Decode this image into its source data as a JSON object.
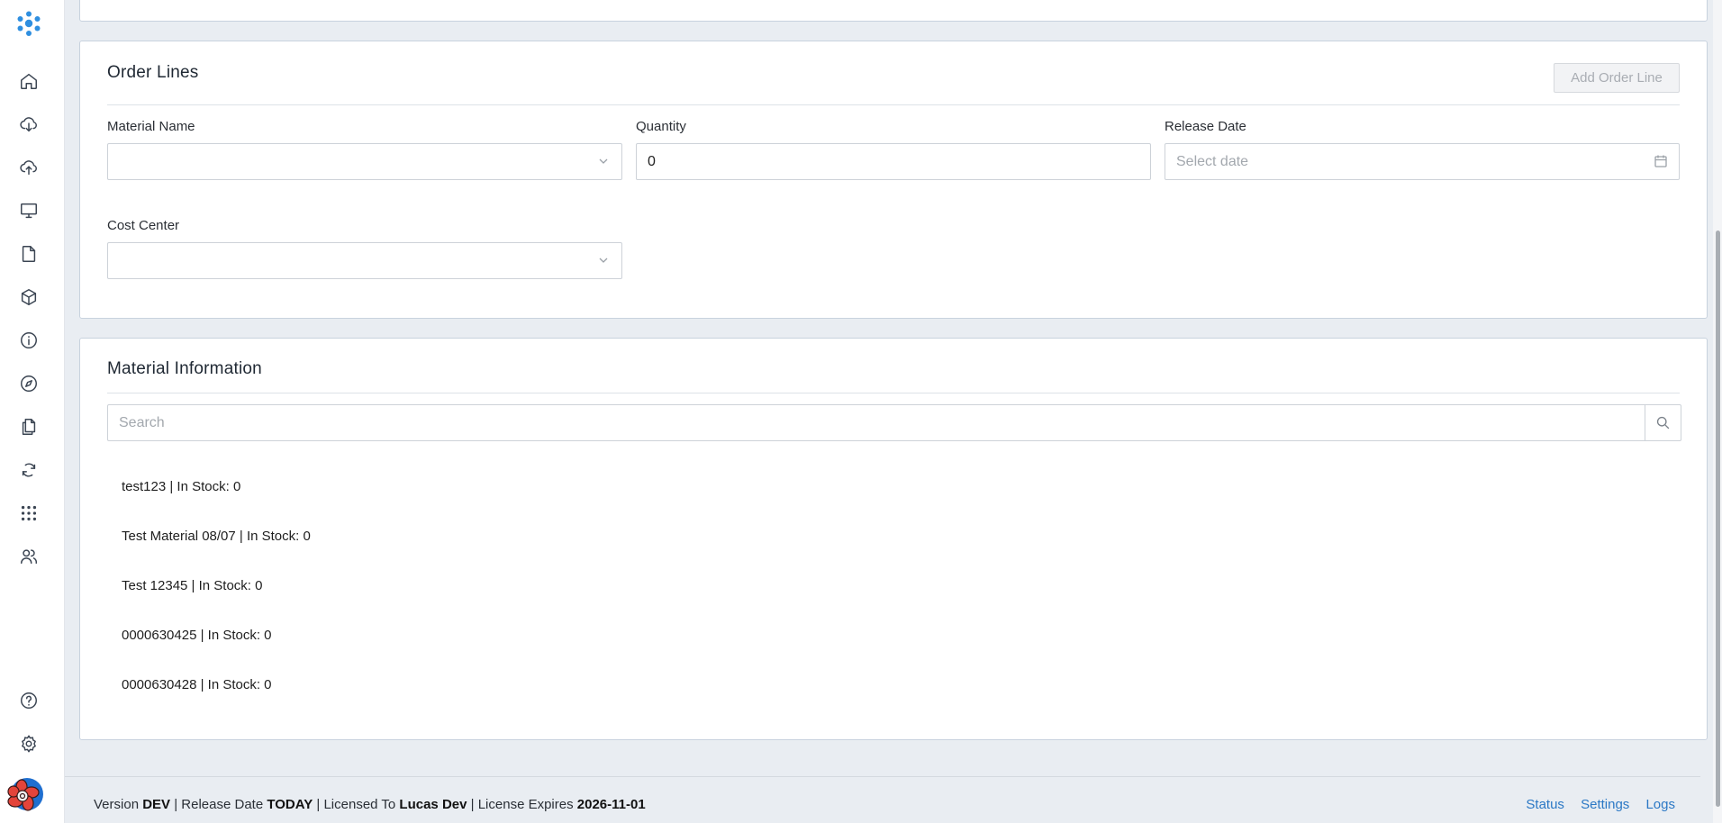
{
  "colors": {
    "accent": "#2b78c5",
    "logo": "#2f8fe0",
    "avatar_bg": "#1f6fd0",
    "avatar_flower": "#e3443b"
  },
  "sidebar": {
    "items": [
      {
        "icon": "home-icon"
      },
      {
        "icon": "cloud-download-icon"
      },
      {
        "icon": "cloud-upload-icon"
      },
      {
        "icon": "monitor-icon"
      },
      {
        "icon": "file-icon"
      },
      {
        "icon": "cube-icon"
      },
      {
        "icon": "info-icon"
      },
      {
        "icon": "compass-icon"
      },
      {
        "icon": "documents-icon"
      },
      {
        "icon": "sync-icon"
      },
      {
        "icon": "apps-grid-icon"
      },
      {
        "icon": "users-icon"
      }
    ],
    "bottom_items": [
      {
        "icon": "help-icon"
      },
      {
        "icon": "settings-icon"
      }
    ]
  },
  "order_lines": {
    "title": "Order Lines",
    "add_button": "Add Order Line",
    "material_name": {
      "label": "Material Name",
      "value": ""
    },
    "quantity": {
      "label": "Quantity",
      "value": "0"
    },
    "release_date": {
      "label": "Release Date",
      "placeholder": "Select date"
    },
    "cost_center": {
      "label": "Cost Center",
      "value": ""
    }
  },
  "material_info": {
    "title": "Material Information",
    "search_placeholder": "Search",
    "items": [
      "test123 | In Stock: 0",
      "Test Material 08/07 | In Stock: 0",
      "Test 12345 | In Stock: 0",
      "0000630425 | In Stock: 0",
      "0000630428 | In Stock: 0"
    ]
  },
  "footer": {
    "version_label": "Version",
    "version": "DEV",
    "release_label": "Release Date",
    "release": "TODAY",
    "licensed_label": "Licensed To",
    "licensed": "Lucas Dev",
    "expires_label": "License Expires",
    "expires": "2026-11-01",
    "links": [
      "Status",
      "Settings",
      "Logs"
    ]
  }
}
